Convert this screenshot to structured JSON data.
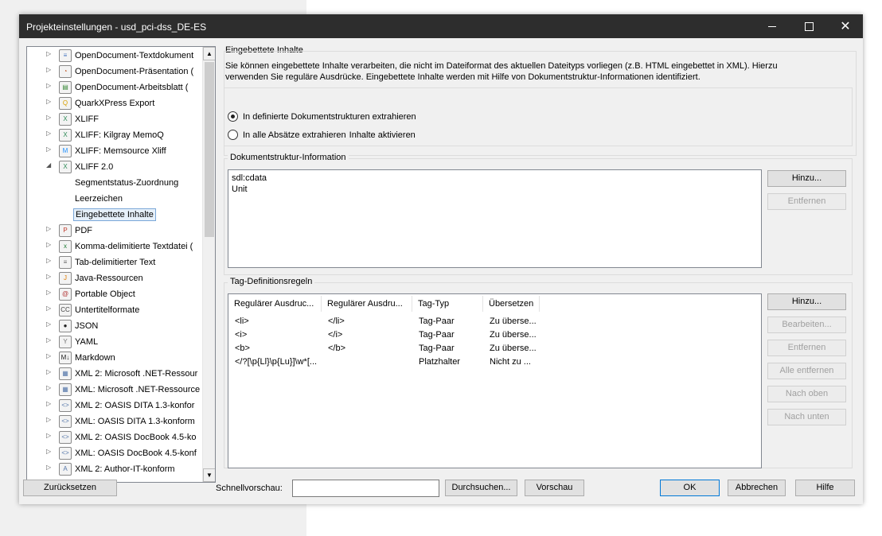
{
  "window": {
    "title": "Projekteinstellungen - usd_pci-dss_DE-ES"
  },
  "tree": {
    "items": [
      {
        "label": "OpenDocument-Textdokument",
        "icon": "odt-icon",
        "glyph": "≡"
      },
      {
        "label": "OpenDocument-Präsentation (",
        "icon": "odp-icon",
        "glyph": "◔"
      },
      {
        "label": "OpenDocument-Arbeitsblatt (",
        "icon": "ods-icon",
        "glyph": "▤"
      },
      {
        "label": "QuarkXPress Export",
        "icon": "quark-icon",
        "glyph": "Q"
      },
      {
        "label": "XLIFF",
        "icon": "xliff-icon",
        "glyph": "X"
      },
      {
        "label": "XLIFF: Kilgray MemoQ",
        "icon": "xliff-icon",
        "glyph": "X"
      },
      {
        "label": "XLIFF: Memsource Xliff",
        "icon": "memsource-icon",
        "glyph": "M"
      },
      {
        "label": "XLIFF 2.0",
        "icon": "xliff-icon",
        "glyph": "X",
        "expanded": true
      },
      {
        "label": "Segmentstatus-Zuordnung",
        "sub": true
      },
      {
        "label": "Leerzeichen",
        "sub": true
      },
      {
        "label": "Eingebettete Inhalte",
        "sub": true,
        "selected": true
      },
      {
        "label": "PDF",
        "icon": "pdf-icon",
        "glyph": "P"
      },
      {
        "label": "Komma-delimitierte Textdatei (",
        "icon": "csv-icon",
        "glyph": "x"
      },
      {
        "label": "Tab-delimitierter Text",
        "icon": "txt-icon",
        "glyph": "≡"
      },
      {
        "label": "Java-Ressourcen",
        "icon": "java-icon",
        "glyph": "J"
      },
      {
        "label": "Portable Object",
        "icon": "po-icon",
        "glyph": "@"
      },
      {
        "label": "Untertitelformate",
        "icon": "cc-icon",
        "glyph": "CC"
      },
      {
        "label": "JSON",
        "icon": "json-icon",
        "glyph": "●"
      },
      {
        "label": "YAML",
        "icon": "yaml-icon",
        "glyph": "Y"
      },
      {
        "label": "Markdown",
        "icon": "markdown-icon",
        "glyph": "M↓"
      },
      {
        "label": "XML 2: Microsoft .NET-Ressour",
        "icon": "xml-icon",
        "glyph": "▦"
      },
      {
        "label": "XML: Microsoft .NET-Ressource",
        "icon": "xml-icon",
        "glyph": "▦"
      },
      {
        "label": "XML 2: OASIS DITA 1.3-konfor",
        "icon": "xml-icon",
        "glyph": "<>"
      },
      {
        "label": "XML: OASIS DITA 1.3-konform",
        "icon": "xml-icon",
        "glyph": "<>"
      },
      {
        "label": "XML 2: OASIS DocBook 4.5-ko",
        "icon": "xml-icon",
        "glyph": "<>"
      },
      {
        "label": "XML: OASIS DocBook 4.5-konf",
        "icon": "xml-icon",
        "glyph": "<>"
      },
      {
        "label": "XML 2: Author-IT-konform",
        "icon": "xml-icon",
        "glyph": "A"
      }
    ]
  },
  "panel": {
    "title": "Eingebettete Inhalte",
    "description_line1": "Sie können eingebettete Inhalte verarbeiten, die nicht im Dateiformat des aktuellen Dateityps vorliegen (z.B. HTML eingebettet in XML). Hierzu",
    "description_line2": "verwenden Sie reguläre Ausdrücke. Eingebettete Inhalte werden mit Hilfe von Dokumentstruktur-Informationen identifiziert.",
    "radio1": "In definierte Dokumentstrukturen extrahieren",
    "radio2": "In alle Absätze extrahieren",
    "radio2_extra": "Inhalte aktivieren",
    "structure": {
      "legend": "Dokumentstruktur-Information",
      "items": [
        "sdl:cdata",
        "Unit"
      ],
      "add": "Hinzu...",
      "remove": "Entfernen"
    },
    "tags": {
      "legend": "Tag-Definitionsregeln",
      "columns": [
        "Regulärer Ausdruc...",
        "Regulärer Ausdru...",
        "Tag-Typ",
        "Übersetzen"
      ],
      "rows": [
        [
          "<li>",
          "</li>",
          "Tag-Paar",
          "Zu überse..."
        ],
        [
          "<i>",
          "</i>",
          "Tag-Paar",
          "Zu überse..."
        ],
        [
          "<b>",
          "</b>",
          "Tag-Paar",
          "Zu überse..."
        ],
        [
          "</?[\\p{Ll}\\p{Lu}]\\w*[...",
          "",
          "Platzhalter",
          "Nicht zu ..."
        ]
      ],
      "add": "Hinzu...",
      "edit": "Bearbeiten...",
      "remove": "Entfernen",
      "remove_all": "Alle entfernen",
      "up": "Nach oben",
      "down": "Nach unten"
    }
  },
  "footer": {
    "reset": "Zurücksetzen",
    "quickpreview_label": "Schnellvorschau:",
    "quickpreview_value": "",
    "browse": "Durchsuchen...",
    "preview": "Vorschau",
    "ok": "OK",
    "cancel": "Abbrechen",
    "help": "Hilfe"
  }
}
